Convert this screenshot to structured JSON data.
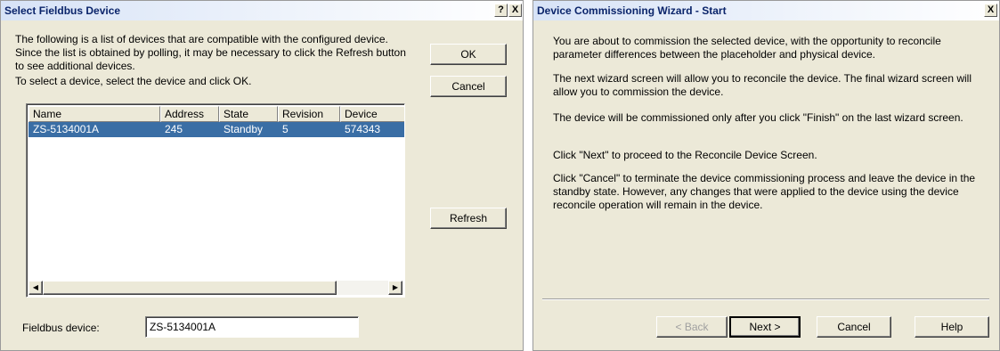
{
  "select_dialog": {
    "title": "Select Fieldbus Device",
    "help_glyph": "?",
    "close_glyph": "X",
    "description": "The following is a list of devices that are compatible with the configured device. Since the list is obtained by polling, it may be necessary to click the Refresh button to see additional devices.",
    "instruction": "To select a device, select the device and click OK.",
    "ok_label": "OK",
    "cancel_label": "Cancel",
    "refresh_label": "Refresh",
    "columns": [
      "Name",
      "Address",
      "State",
      "Revision",
      "Device"
    ],
    "rows": [
      {
        "name": "ZS-5134001A",
        "address": "245",
        "state": "Standby",
        "revision": "5",
        "device": "574343"
      }
    ],
    "fieldbus_label": "Fieldbus device:",
    "fieldbus_value": "ZS-5134001A"
  },
  "wizard_dialog": {
    "title": "Device Commissioning Wizard - Start",
    "close_glyph": "X",
    "paragraphs": [
      "You are about to commission the selected device, with the opportunity to reconcile parameter differences between the placeholder and physical device.",
      "The next wizard screen will allow you to reconcile the device. The final wizard screen will allow you to commission the device.",
      "The device will be commissioned only after you click \"Finish\" on the last wizard screen.",
      "Click \"Next\" to proceed to the Reconcile Device Screen.",
      "Click \"Cancel\" to terminate the device commissioning process and leave the device in the standby state. However, any changes that were applied to the device using the device reconcile operation will remain in the device."
    ],
    "back_label": "< Back",
    "next_label": "Next >",
    "cancel_label": "Cancel",
    "help_label": "Help"
  },
  "colors": {
    "selection": "#3a6ea5",
    "dialog_bg": "#ece9d8",
    "title_text": "#0a246a"
  }
}
